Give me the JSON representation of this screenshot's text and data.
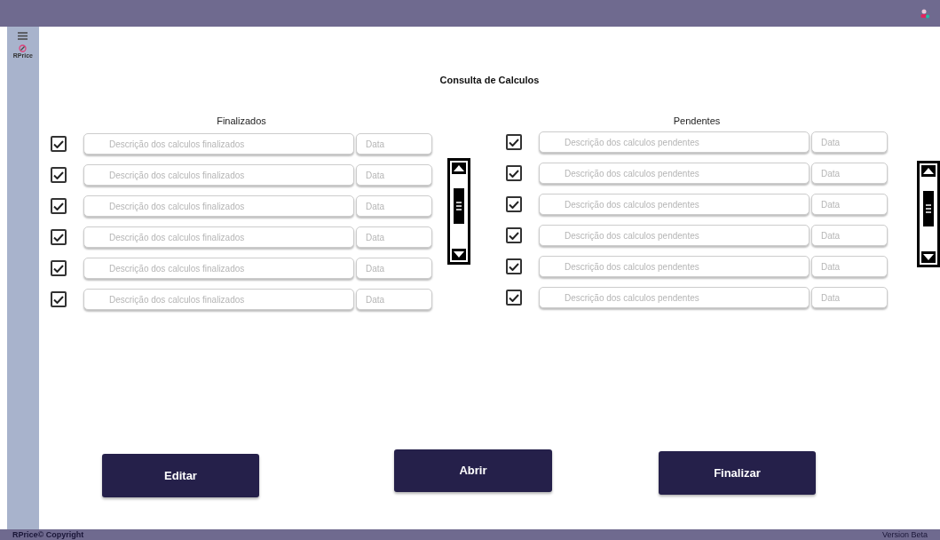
{
  "app": {
    "name": "RPrice"
  },
  "page_title": "Consulta de Calculos",
  "lists": [
    {
      "heading": "Finalizados",
      "rows": [
        {
          "checked": true,
          "description": {
            "placeholder": "Descrição dos calculos finalizados"
          },
          "date": {
            "placeholder": "Data"
          }
        },
        {
          "checked": true,
          "description": {
            "placeholder": "Descrição dos calculos finalizados"
          },
          "date": {
            "placeholder": "Data"
          }
        },
        {
          "checked": true,
          "description": {
            "placeholder": "Descrição dos calculos finalizados"
          },
          "date": {
            "placeholder": "Data"
          }
        },
        {
          "checked": true,
          "description": {
            "placeholder": "Descrição dos calculos finalizados"
          },
          "date": {
            "placeholder": "Data"
          }
        },
        {
          "checked": true,
          "description": {
            "placeholder": "Descrição dos calculos finalizados"
          },
          "date": {
            "placeholder": "Data"
          }
        },
        {
          "checked": true,
          "description": {
            "placeholder": "Descrição dos calculos finalizados"
          },
          "date": {
            "placeholder": "Data"
          }
        }
      ]
    },
    {
      "heading": "Pendentes",
      "rows": [
        {
          "checked": true,
          "description": {
            "placeholder": "Descrição dos calculos pendentes"
          },
          "date": {
            "placeholder": "Data"
          }
        },
        {
          "checked": true,
          "description": {
            "placeholder": "Descrição dos calculos pendentes"
          },
          "date": {
            "placeholder": "Data"
          }
        },
        {
          "checked": true,
          "description": {
            "placeholder": "Descrição dos calculos pendentes"
          },
          "date": {
            "placeholder": "Data"
          }
        },
        {
          "checked": true,
          "description": {
            "placeholder": "Descrição dos calculos pendentes"
          },
          "date": {
            "placeholder": "Data"
          }
        },
        {
          "checked": true,
          "description": {
            "placeholder": "Descrição dos calculos pendentes"
          },
          "date": {
            "placeholder": "Data"
          }
        },
        {
          "checked": true,
          "description": {
            "placeholder": "Descrição dos calculos pendentes"
          },
          "date": {
            "placeholder": "Data"
          }
        }
      ]
    }
  ],
  "buttons": [
    "Editar",
    "Abrir",
    "Finalizar"
  ],
  "footer": {
    "copyright": "RPrice© Copyright",
    "version": "Version Beta"
  }
}
